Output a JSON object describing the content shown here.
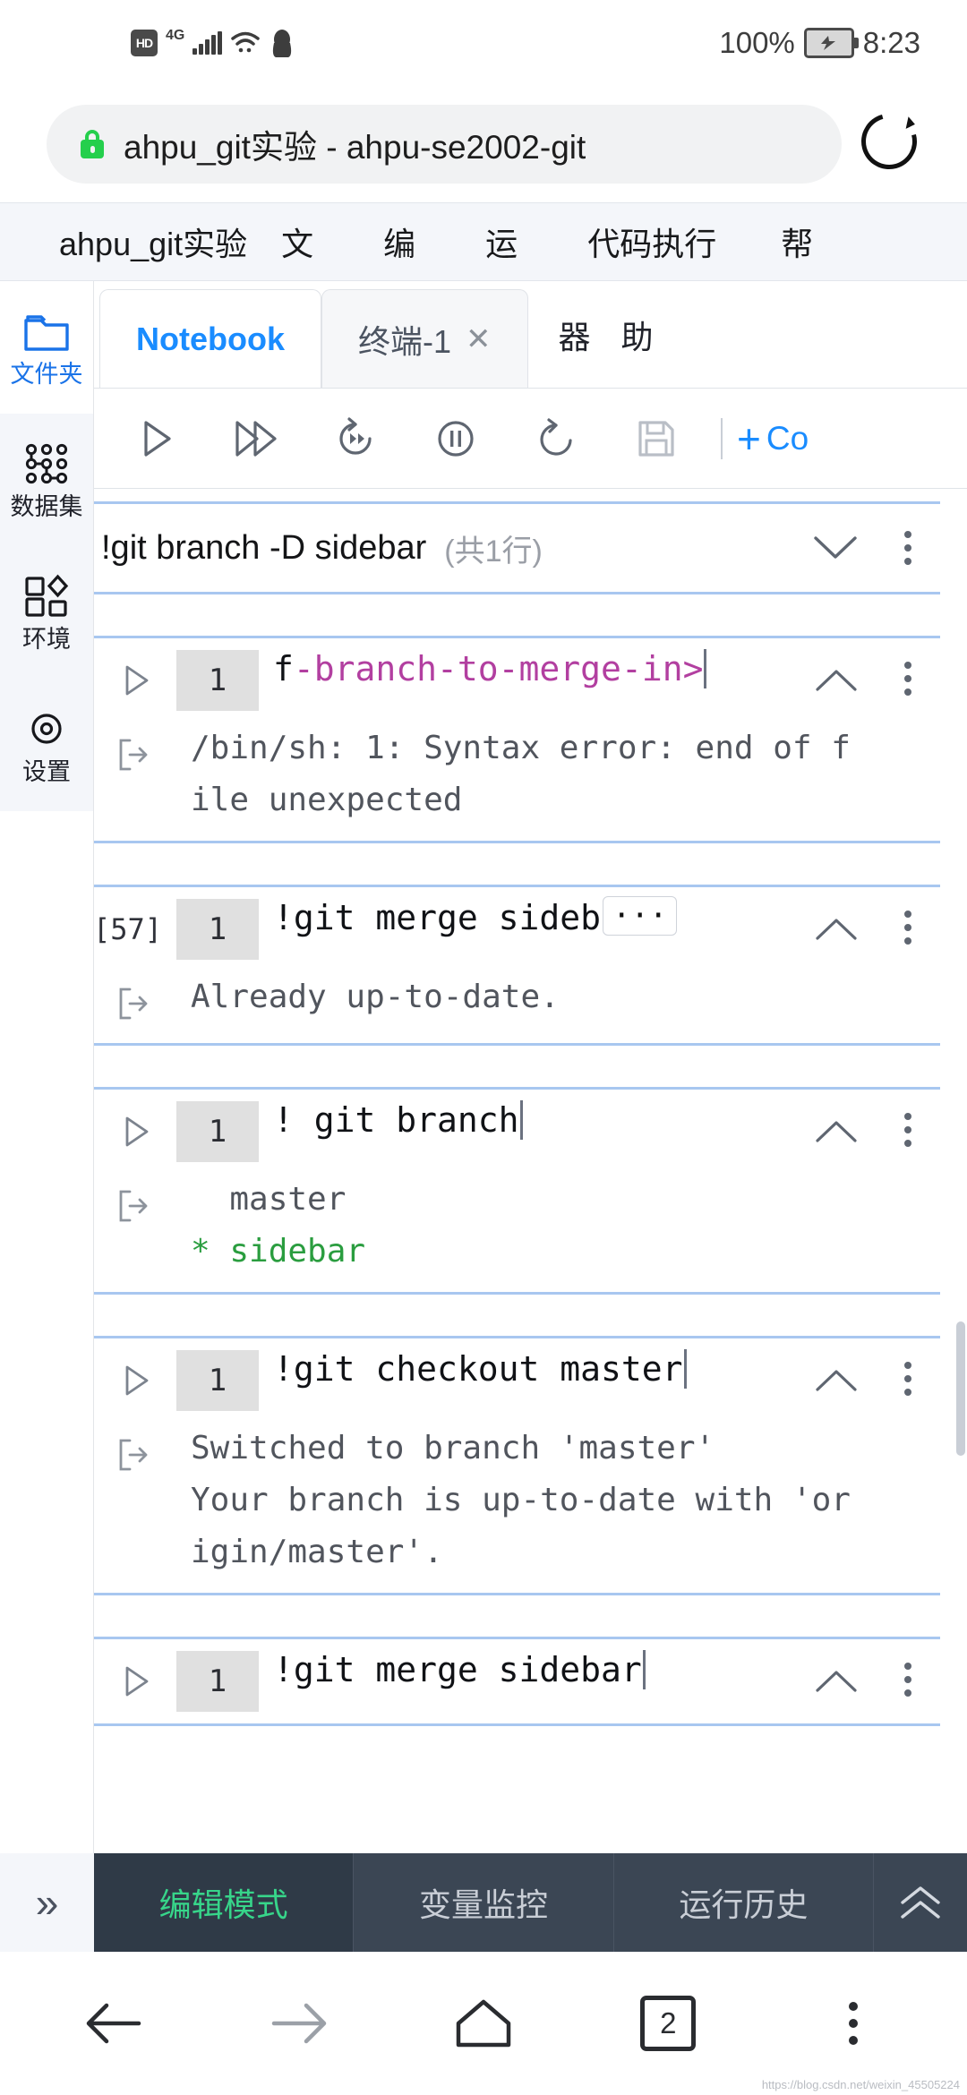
{
  "status_bar": {
    "hd_badge": "HD",
    "network": "4G",
    "battery_percent": "100%",
    "clock": "8:23",
    "icons": [
      "hd-icon",
      "signal-bars-icon",
      "wifi-icon",
      "qq-penguin-icon",
      "battery-icon"
    ]
  },
  "browser": {
    "url_title": "ahpu_git实验 - ahpu-se2002-git",
    "lock_icon": "lock-icon",
    "reload_icon": "reload-icon"
  },
  "menubar": {
    "title": "ahpu_git实验",
    "items": [
      "文",
      "编",
      "运",
      "代码执行",
      "帮"
    ]
  },
  "sidebar": {
    "items": [
      {
        "label": "文件夹",
        "icon": "folder-icon",
        "active": true
      },
      {
        "label": "数据集",
        "icon": "dataset-nodes-icon",
        "active": false
      },
      {
        "label": "环境",
        "icon": "environment-shapes-icon",
        "active": false
      },
      {
        "label": "设置",
        "icon": "gear-icon",
        "active": false
      }
    ]
  },
  "tabs": [
    {
      "label": "Notebook",
      "active": true,
      "closable": false
    },
    {
      "label": "终端-1",
      "active": false,
      "closable": true,
      "close_label": "✕"
    }
  ],
  "tabs_overflow": [
    "器",
    "助"
  ],
  "toolbar": {
    "buttons": [
      {
        "name": "run-cell-button",
        "icon": "play-icon"
      },
      {
        "name": "run-all-button",
        "icon": "fast-forward-icon"
      },
      {
        "name": "restart-run-button",
        "icon": "restart-run-icon"
      },
      {
        "name": "interrupt-button",
        "icon": "pause-circle-icon"
      },
      {
        "name": "restart-kernel-button",
        "icon": "restart-icon"
      },
      {
        "name": "save-button",
        "icon": "save-disk-icon"
      }
    ],
    "add_label": "Co",
    "add_plus": "+"
  },
  "command_row": {
    "text": "!git branch -D sidebar",
    "count": "(共1行)",
    "chevron_icon": "chevron-down-icon",
    "kebab_icon": "more-vertical-icon"
  },
  "cells": [
    {
      "exec_label": "",
      "run_icon": "play-outline-icon",
      "line_number": "1",
      "code_plain": "f",
      "code_kw": "-branch-to-merge-in",
      "code_tail": ">",
      "has_caret": true,
      "has_ellipsis": false,
      "collapse_icon": "chevron-up-icon",
      "kebab_icon": "more-vertical-icon",
      "output_icon": "output-arrow-icon",
      "output": "/bin/sh: 1: Syntax error: end of f\nile unexpected",
      "output_color": "gray"
    },
    {
      "exec_label": "[57]",
      "run_icon": "",
      "line_number": "1",
      "code_plain": "!git merge sideb",
      "code_kw": "",
      "code_tail": "",
      "has_caret": false,
      "has_ellipsis": true,
      "ellipsis_label": "···",
      "collapse_icon": "chevron-up-icon",
      "kebab_icon": "more-vertical-icon",
      "output_icon": "output-arrow-icon",
      "output": "Already up-to-date.",
      "output_color": "gray"
    },
    {
      "exec_label": "",
      "run_icon": "play-outline-icon",
      "line_number": "1",
      "code_plain": "!  git branch",
      "code_kw": "",
      "code_tail": "",
      "has_caret": true,
      "has_ellipsis": false,
      "collapse_icon": "chevron-up-icon",
      "kebab_icon": "more-vertical-icon",
      "output_icon": "output-arrow-icon",
      "output_lines": [
        {
          "text": "  master",
          "color": "gray"
        },
        {
          "text": "* sidebar",
          "color": "green"
        }
      ],
      "output_color": "mixed"
    },
    {
      "exec_label": "",
      "run_icon": "play-outline-icon",
      "line_number": "1",
      "code_plain": "!git checkout master",
      "code_kw": "",
      "code_tail": "",
      "has_caret": true,
      "has_ellipsis": false,
      "collapse_icon": "chevron-up-icon",
      "kebab_icon": "more-vertical-icon",
      "output_icon": "output-arrow-icon",
      "output": "Switched to branch 'master'\nYour branch is up-to-date with 'or\nigin/master'.",
      "output_color": "gray"
    },
    {
      "exec_label": "",
      "run_icon": "play-outline-icon",
      "line_number": "1",
      "code_plain": "!git merge sidebar",
      "code_kw": "",
      "code_tail": "",
      "has_caret": true,
      "has_ellipsis": false,
      "collapse_icon": "chevron-up-icon",
      "kebab_icon": "more-vertical-icon",
      "output_icon": "",
      "output": "",
      "output_color": "gray"
    }
  ],
  "app_bar": {
    "expand_icon": "chevron-double-right-icon",
    "buttons": [
      {
        "label": "编辑模式",
        "active": true
      },
      {
        "label": "变量监控",
        "active": false
      },
      {
        "label": "运行历史",
        "active": false
      }
    ],
    "up_icon": "chevron-double-up-icon"
  },
  "nav_bar": {
    "back_icon": "arrow-left-icon",
    "forward_icon": "arrow-right-icon",
    "home_icon": "home-icon",
    "tabs_count": "2",
    "menu_icon": "more-vertical-icon"
  },
  "watermark": "https://blog.csdn.net/weixin_45505224"
}
